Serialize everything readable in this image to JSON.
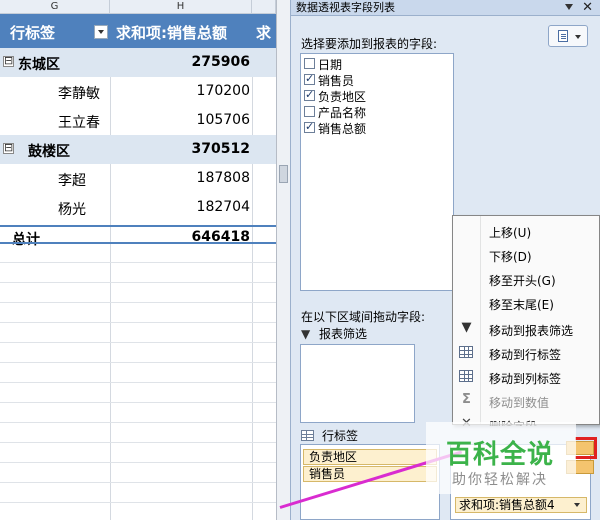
{
  "sheet": {
    "columns": [
      "G",
      "H"
    ],
    "header": {
      "row_label": "行标签",
      "sum_label": "求和项:销售总额",
      "next_col_partial": "求"
    },
    "rows": [
      {
        "type": "group",
        "expander": "⊟",
        "label": "东城区",
        "value": "275906"
      },
      {
        "type": "item",
        "label": "李静敏",
        "value": "170200"
      },
      {
        "type": "item",
        "label": "王立春",
        "value": "105706"
      },
      {
        "type": "group",
        "expander": "⊟",
        "label": "鼓楼区",
        "value": "370512"
      },
      {
        "type": "item",
        "label": "李超",
        "value": "187808"
      },
      {
        "type": "item",
        "label": "杨光",
        "value": "182704"
      }
    ],
    "total": {
      "label": "总计",
      "value": "646418"
    }
  },
  "pane": {
    "title": "数据透视表字段列表",
    "prompt": "选择要添加到报表的字段:",
    "fields": [
      {
        "name": "日期",
        "checked": false
      },
      {
        "name": "销售员",
        "checked": true
      },
      {
        "name": "负责地区",
        "checked": true
      },
      {
        "name": "产品名称",
        "checked": false
      },
      {
        "name": "销售总额",
        "checked": true
      }
    ],
    "drag_prompt": "在以下区域间拖动字段:",
    "filter_label": "报表筛选",
    "rows_label": "行标签",
    "row_fields": [
      "负责地区",
      "销售员"
    ],
    "values_field": "求和项:销售总额4"
  },
  "context_menu": {
    "items": [
      {
        "label": "上移(U)",
        "icon": "",
        "disabled": false
      },
      {
        "label": "下移(D)",
        "icon": "",
        "disabled": false
      },
      {
        "label": "移至开头(G)",
        "icon": "",
        "disabled": false
      },
      {
        "label": "移至末尾(E)",
        "icon": "",
        "disabled": false
      },
      {
        "label": "移动到报表筛选",
        "icon": "filter-icon",
        "disabled": false
      },
      {
        "label": "移动到行标签",
        "icon": "row-labels-icon",
        "disabled": false
      },
      {
        "label": "移动到列标签",
        "icon": "column-labels-icon",
        "disabled": false
      },
      {
        "label": "移动到数值",
        "icon": "sigma-icon",
        "disabled": true
      },
      {
        "label": "删除字段",
        "icon": "delete-icon",
        "disabled": false
      }
    ]
  },
  "watermark": {
    "title": "百科全说",
    "subtitle": "助你轻松解决"
  },
  "colors": {
    "pivot_header": "#4f81bd",
    "group_band": "#dce6f1",
    "pane_bg": "#dfe8f3",
    "field_chip": "#fdf0cf",
    "watermark_green": "#3cb34a",
    "highlight_line": "#d92bd0"
  }
}
